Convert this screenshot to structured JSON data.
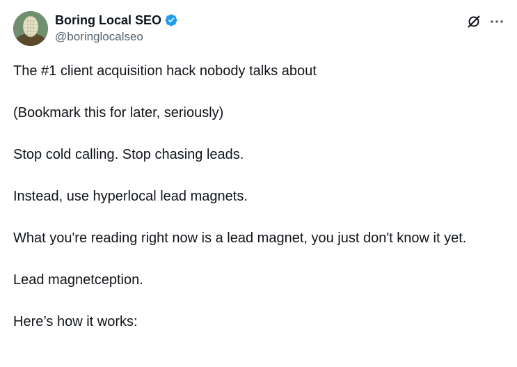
{
  "author": {
    "display_name": "Boring Local SEO",
    "handle": "@boringlocalseo",
    "verified": true,
    "verified_color": "#1d9bf0"
  },
  "icons": {
    "grok": "grok-icon",
    "more": "more-options-icon",
    "verified": "verified-badge-icon"
  },
  "tweet": {
    "paragraphs": [
      "The #1 client acquisition hack nobody talks about",
      "(Bookmark this for later, seriously)",
      "Stop cold calling. Stop chasing leads.",
      "Instead, use hyperlocal lead magnets.",
      "What you're reading right now is a lead magnet, you just don't know it yet.",
      "Lead magnetception.",
      "Here’s how it works:"
    ]
  },
  "colors": {
    "text": "#0f1419",
    "secondary": "#536471",
    "accent": "#1d9bf0"
  }
}
